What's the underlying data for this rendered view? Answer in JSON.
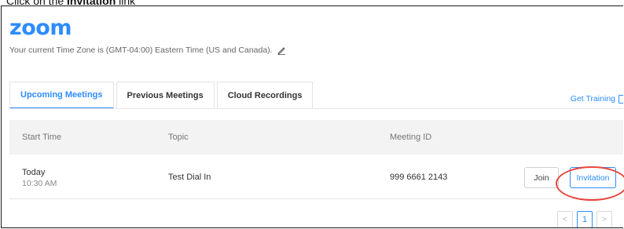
{
  "instruction": {
    "prefix": "Click on the ",
    "target": "Invitation",
    "suffix": " link"
  },
  "header": {
    "logo": "zoom",
    "timezone_text": "Your current Time Zone is (GMT-04:00) Eastern Time (US and Canada)."
  },
  "tabs": [
    {
      "label": "Upcoming Meetings",
      "active": true
    },
    {
      "label": "Previous Meetings",
      "active": false
    },
    {
      "label": "Cloud Recordings",
      "active": false
    }
  ],
  "get_training_label": "Get Training",
  "table": {
    "columns": {
      "start_time": "Start Time",
      "topic": "Topic",
      "meeting_id": "Meeting ID"
    },
    "rows": [
      {
        "day": "Today",
        "time": "10:30 AM",
        "topic": "Test Dial In",
        "meeting_id": "999 6661 2143",
        "join_label": "Join",
        "invitation_label": "Invitation"
      }
    ]
  },
  "pagination": {
    "prev": "<",
    "current": "1",
    "next": ">"
  },
  "colors": {
    "accent": "#2d8cff",
    "highlight": "#e8453c"
  }
}
